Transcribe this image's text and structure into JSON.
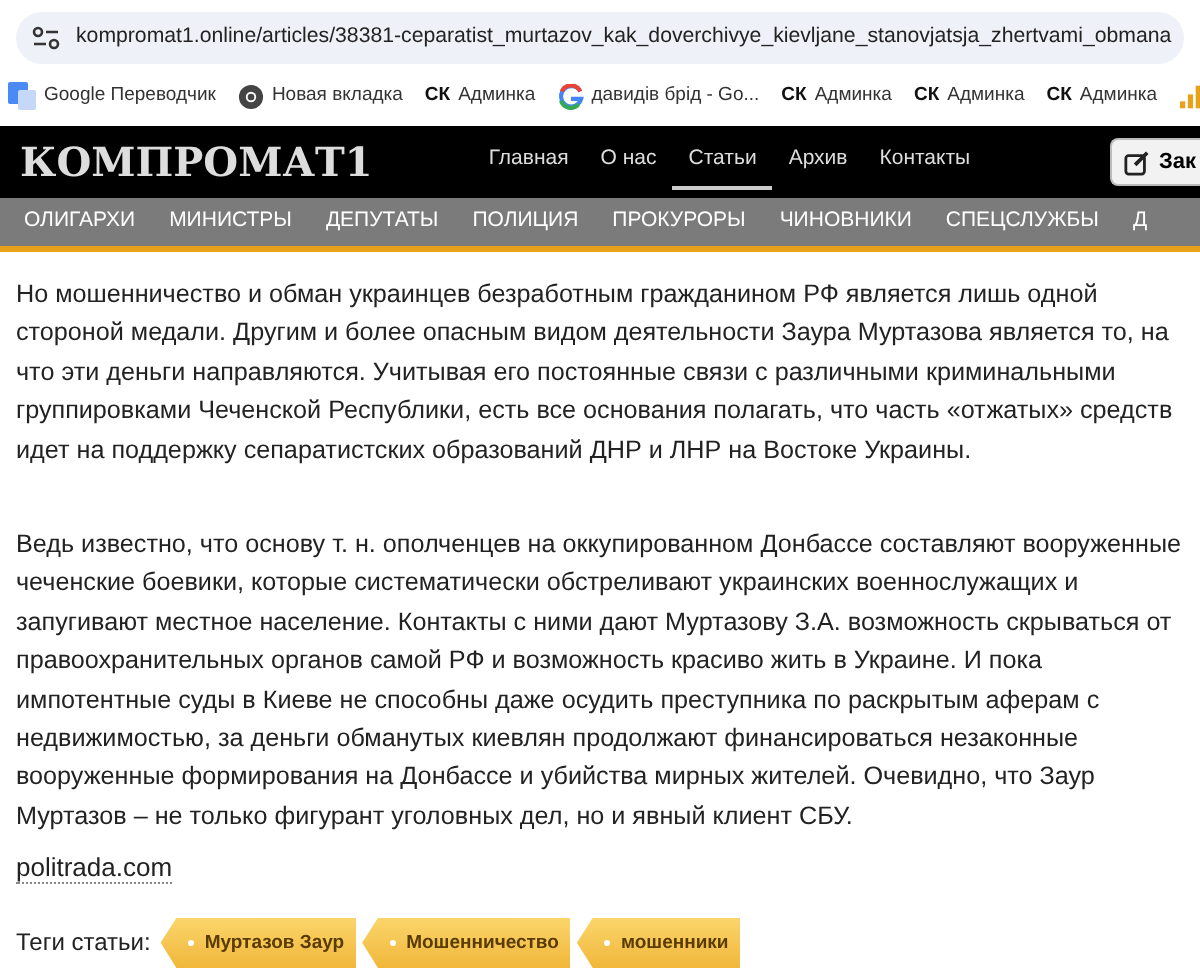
{
  "address_bar": {
    "url": "kompromat1.online/articles/38381-ceparatist_murtazov_kak_doverchivye_kievljane_stanovjatsja_zhertvami_obmana"
  },
  "bookmarks": [
    {
      "kind": "translate",
      "label": "Google Переводчик"
    },
    {
      "kind": "browser",
      "label": "Новая вкладка"
    },
    {
      "kind": "text",
      "logo_text": "СК",
      "label": "Админка"
    },
    {
      "kind": "google",
      "label": "давидів брід - Go..."
    },
    {
      "kind": "text",
      "logo_text": "СК",
      "label": "Админка"
    },
    {
      "kind": "text",
      "logo_text": "СК",
      "label": "Админка"
    },
    {
      "kind": "text",
      "logo_text": "СК",
      "label": "Админка"
    },
    {
      "kind": "chart"
    }
  ],
  "site_header": {
    "logo": "КОМПРОМАТ1",
    "menu": [
      {
        "label": "Главная",
        "selected": false
      },
      {
        "label": "О нас",
        "selected": false
      },
      {
        "label": "Статьи",
        "selected": true
      },
      {
        "label": "Архив",
        "selected": false
      },
      {
        "label": "Контакты",
        "selected": false
      }
    ],
    "button": "Зак"
  },
  "categories": [
    "ОЛИГАРХИ",
    "МИНИСТРЫ",
    "ДЕПУТАТЫ",
    "ПОЛИЦИЯ",
    "ПРОКУРОРЫ",
    "ЧИНОВНИКИ",
    "СПЕЦСЛУЖБЫ",
    "Д"
  ],
  "article": {
    "paragraphs": [
      "Но мошенничество и обман украинцев безработным гражданином РФ является лишь одной стороной медали. Другим и более опасным видом деятельности Заура Муртазова является то, на что эти деньги направляются. Учитывая его постоянные связи с различными криминальными группировками Чеченской Республики, есть все основания полагать, что часть «отжатых» средств идет на поддержку сепаратистских образований ДНР и ЛНР на Востоке Украины.",
      "Ведь известно, что основу т. н. ополченцев на оккупированном Донбассе составляют вооруженные чеченские боевики, которые систематически обстреливают украинских военнослужащих и запугивают местное население. Контакты с ними дают Муртазову З.А. возможность скрываться от правоохранительных органов самой РФ и возможность красиво жить в Украине. И пока импотентные суды в Киеве не способны даже осудить преступника по раскрытым аферам с недвижимостью, за деньги обманутых киевлян продолжают финансироваться незаконные вооруженные формирования на Донбассе и убийства мирных жителей. Очевидно, что Заур Муртазов – не только фигурант уголовных дел, но и явный клиент СБУ."
    ],
    "source": "politrada.com",
    "tags_label": "Теги статьи:",
    "tags": [
      "Муртазов Заур",
      "Мошенничество",
      "мошенники"
    ]
  }
}
